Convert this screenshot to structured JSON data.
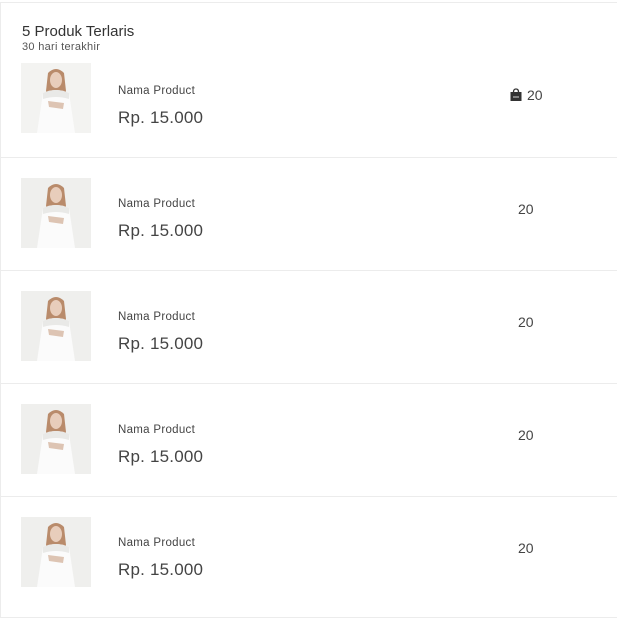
{
  "header": {
    "title": "5 Produk Terlaris",
    "subtitle": "30 hari terakhir"
  },
  "products": [
    {
      "name": "Nama Product",
      "price": "Rp. 15.000",
      "sold": "20",
      "sold_icon": "shopping-bag-icon"
    },
    {
      "name": "Nama Product",
      "price": "Rp. 15.000",
      "sold": "20"
    },
    {
      "name": "Nama Product",
      "price": "Rp. 15.000",
      "sold": "20"
    },
    {
      "name": "Nama Product",
      "price": "Rp. 15.000",
      "sold": "20"
    },
    {
      "name": "Nama Product",
      "price": "Rp. 15.000",
      "sold": "20"
    }
  ],
  "colors": {
    "text": "#444444",
    "divider": "#ececec",
    "thumb_bg": "#efefed"
  }
}
